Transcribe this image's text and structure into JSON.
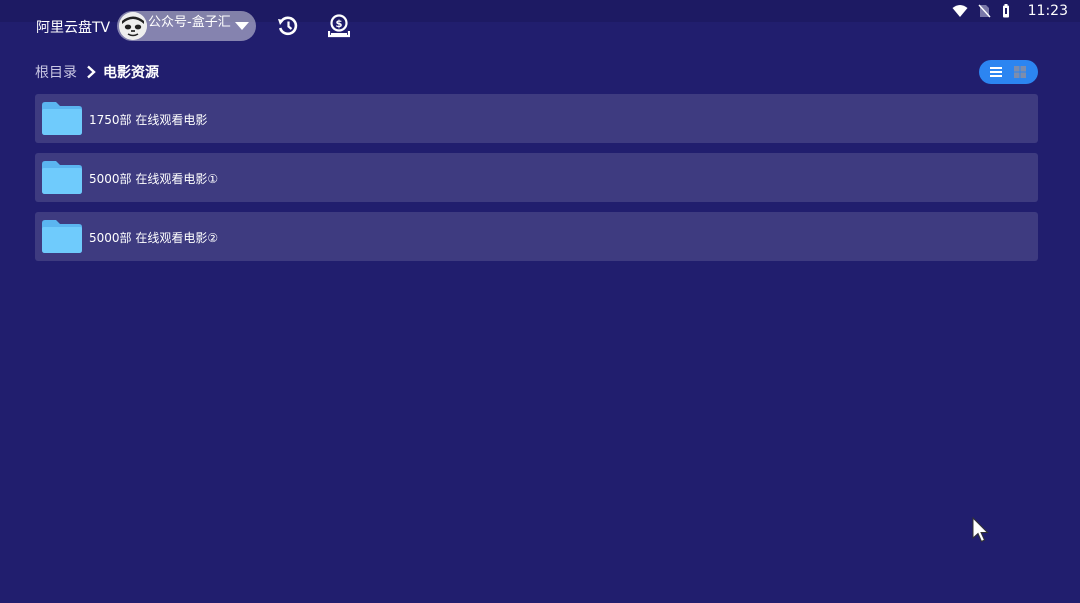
{
  "status_bar": {
    "time": "11:23",
    "icons": [
      "wifi-icon",
      "no-sim-icon",
      "battery-icon"
    ]
  },
  "header": {
    "app_title": "阿里云盘TV",
    "account": {
      "name": "公众号-盒子汇",
      "avatar_icon": "avatar",
      "dropdown_icon": "chevron-down-icon"
    },
    "history_icon": "history-icon",
    "transfer_icon": "transfer-icon"
  },
  "breadcrumb": {
    "root": "根目录",
    "separator_icon": "chevron-right-icon",
    "current": "电影资源"
  },
  "view_toggle": {
    "options": [
      "list-view-icon",
      "grid-view-icon"
    ],
    "selected": "list-view-icon"
  },
  "folders": [
    {
      "name": "1750部 在线观看电影"
    },
    {
      "name": "5000部 在线观看电影①"
    },
    {
      "name": "5000部 在线观看电影②"
    }
  ],
  "colors": {
    "background": "#211e6e",
    "row": "#3e3b80",
    "folder": "#6ec8fb",
    "accent": "#2c85f1"
  }
}
